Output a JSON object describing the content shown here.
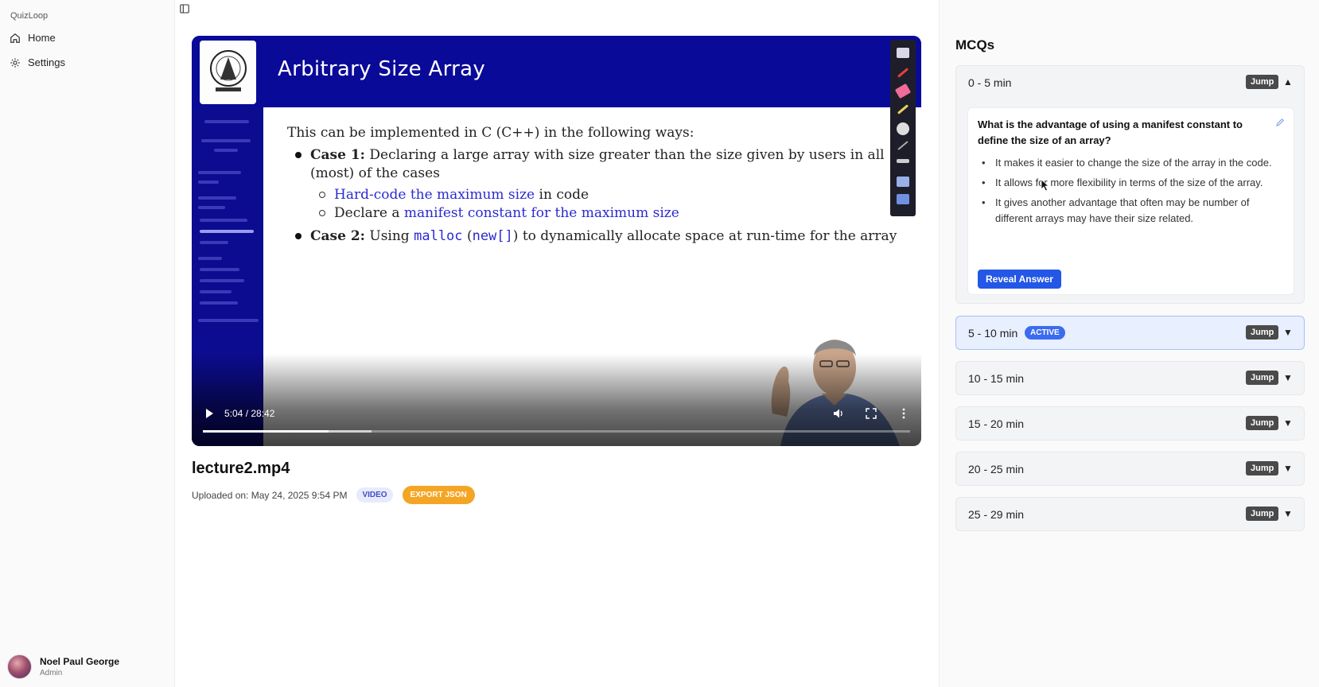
{
  "app": {
    "name": "QuizLoop"
  },
  "sidebar": {
    "items": [
      {
        "label": "Home",
        "icon": "home-icon"
      },
      {
        "label": "Settings",
        "icon": "gear-icon"
      }
    ]
  },
  "user": {
    "name": "Noel Paul George",
    "role": "Admin"
  },
  "video": {
    "slide": {
      "title": "Arbitrary Size Array",
      "intro": "This can be implemented in C (C++) in the following ways:",
      "case1_label": "Case 1:",
      "case1_text": "Declaring a large array with size greater than the size given by users in all",
      "case1_text2": "(most) of the cases",
      "sub1_blue": "Hard-code the maximum size",
      "sub1_rest": "in code",
      "sub2_start": "Declare a",
      "sub2_blue": "manifest constant for the maximum size",
      "case2_label": "Case 2:",
      "case2_using": "Using",
      "case2_malloc": "malloc",
      "case2_open": "(",
      "case2_new": "new[]",
      "case2_close": ")",
      "case2_rest": "to dynamically allocate space at run-time for the array"
    },
    "time": "5:04 / 28:42",
    "progress": 0.178,
    "buffered": 0.238
  },
  "file": {
    "title": "lecture2.mp4",
    "uploaded": "Uploaded on: May 24, 2025 9:54 PM",
    "type_badge": "VIDEO",
    "export_label": "EXPORT JSON"
  },
  "mcq": {
    "heading": "MCQs",
    "jump_label": "Jump",
    "active_label": "ACTIVE",
    "segments": [
      {
        "label": "0 - 5 min",
        "expanded": true
      },
      {
        "label": "5 - 10 min",
        "active": true
      },
      {
        "label": "10 - 15 min"
      },
      {
        "label": "15 - 20 min"
      },
      {
        "label": "20 - 25 min"
      },
      {
        "label": "25 - 29 min"
      }
    ],
    "question": {
      "text": "What is the advantage of using a manifest constant to define the size of an array?",
      "options": [
        "It makes it easier to change the size of the array in the code.",
        "It allows for more flexibility in terms of the size of the array.",
        "It gives another advantage that often may be number of different arrays may have their size related."
      ],
      "reveal_label": "Reveal Answer"
    }
  },
  "colors": {
    "primary": "#2457e6",
    "accent": "#f5a524",
    "active": "#3b6cf0",
    "slide_blue": "#0a0a98"
  }
}
